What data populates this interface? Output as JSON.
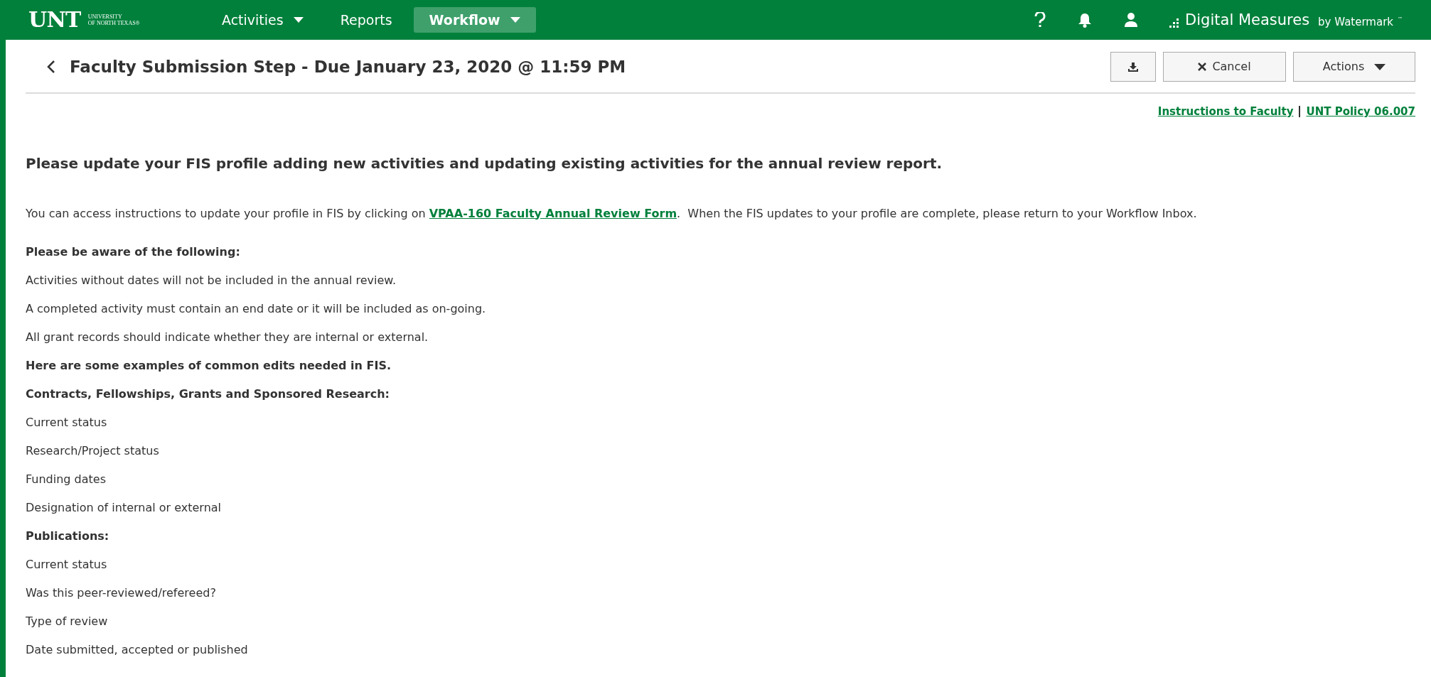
{
  "header": {
    "logo": "UNT",
    "logo_subtitle": [
      "UNIVERSITY",
      "OF NORTH TEXAS®"
    ],
    "nav": [
      {
        "label": "Activities",
        "dropdown": true,
        "selected": false
      },
      {
        "label": "Reports",
        "dropdown": false,
        "selected": false
      },
      {
        "label": "Workflow",
        "dropdown": true,
        "selected": true
      }
    ],
    "brand": "Digital Measures",
    "brand_suffix": "by Watermark",
    "brand_tm": "™"
  },
  "page": {
    "title": "Faculty Submission Step - Due January 23, 2020 @ 11:59 PM",
    "buttons": [
      {
        "kind": "download"
      },
      {
        "kind": "cancel",
        "label": "Cancel"
      },
      {
        "kind": "actions",
        "label": "Actions"
      }
    ]
  },
  "links": [
    "Instructions to Faculty",
    "UNT Policy 06.007"
  ],
  "heading": "Please update your FIS profile adding new activities and updating existing activities for the annual review report.",
  "intro": {
    "before": "You can access instructions to update your profile in FIS by clicking on ",
    "link": "VPAA-160 Faculty Annual Review Form",
    "after": ".  When the FIS updates to your profile are complete, please return to your Workflow Inbox."
  },
  "lines": [
    {
      "kind": "bold",
      "text": "Please be aware of the following:"
    },
    {
      "kind": "plain",
      "text": "Activities without dates will not be included in the annual review."
    },
    {
      "kind": "plain",
      "text": "A completed activity must contain an end date or it will be included as on-going."
    },
    {
      "kind": "plain",
      "text": "All grant records should indicate whether they are internal or external."
    },
    {
      "kind": "bold",
      "text": "Here are some examples of common edits needed in FIS."
    },
    {
      "kind": "bold",
      "text": "Contracts, Fellowships, Grants and Sponsored Research:"
    },
    {
      "kind": "plain",
      "text": "Current status"
    },
    {
      "kind": "plain",
      "text": "Research/Project status"
    },
    {
      "kind": "plain",
      "text": "Funding dates"
    },
    {
      "kind": "plain",
      "text": "Designation of internal or external"
    },
    {
      "kind": "bold",
      "text": "Publications:"
    },
    {
      "kind": "plain",
      "text": "Current status"
    },
    {
      "kind": "plain",
      "text": "Was this peer-reviewed/refereed?"
    },
    {
      "kind": "plain",
      "text": "Type of review"
    },
    {
      "kind": "plain",
      "text": "Date submitted, accepted or published"
    }
  ]
}
